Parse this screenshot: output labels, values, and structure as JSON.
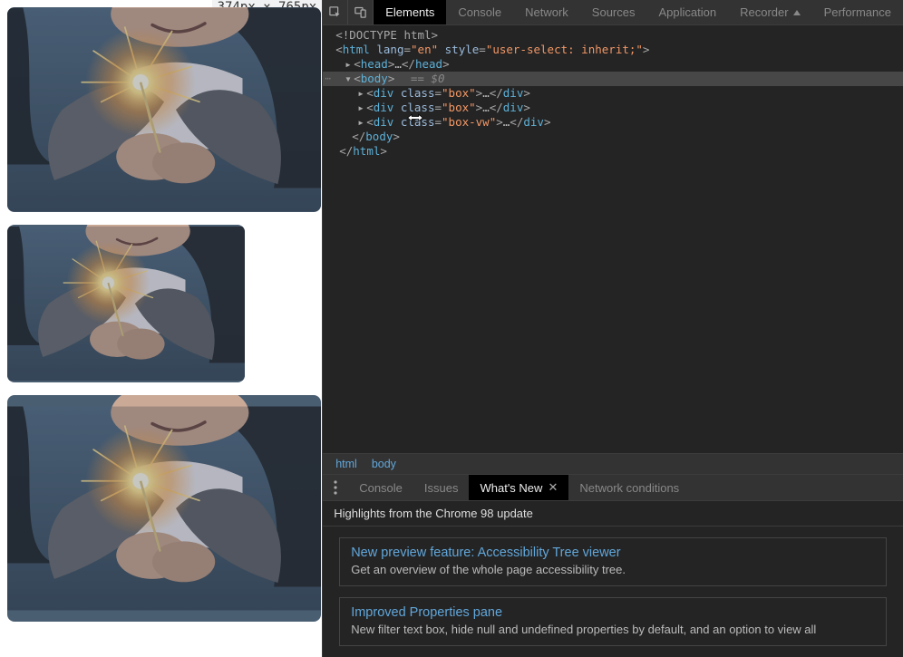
{
  "dim_badge": "374px × 765px",
  "devtools": {
    "tabs": [
      "Elements",
      "Console",
      "Network",
      "Sources",
      "Application",
      "Recorder",
      "Performance"
    ],
    "active_tab_index": 0,
    "dom": {
      "doctype": "<!DOCTYPE html>",
      "html_open_pre": "<",
      "html_tag": "html",
      "html_lang_attr": "lang",
      "html_lang_val": "\"en\"",
      "html_style_attr": "style",
      "html_style_val": "\"user-select: inherit;\"",
      "head_open": "head",
      "head_close": "head",
      "body_open": "body",
      "body_sel_eq": "== ",
      "body_sel_var": "$0",
      "div_tag": "div",
      "class_attr": "class",
      "box_val": "\"box\"",
      "boxvw_val": "\"box-vw\"",
      "body_close": "body",
      "html_close": "html"
    },
    "breadcrumb": [
      "html",
      "body"
    ],
    "drawer": {
      "tabs": [
        "Console",
        "Issues",
        "What's New",
        "Network conditions"
      ],
      "active_tab_index": 2,
      "headline": "Highlights from the Chrome 98 update",
      "cards": [
        {
          "title": "New preview feature: Accessibility Tree viewer",
          "desc": "Get an overview of the whole page accessibility tree."
        },
        {
          "title": "Improved Properties pane",
          "desc": "New filter text box, hide null and undefined properties by default, and an option to view all"
        }
      ]
    }
  }
}
